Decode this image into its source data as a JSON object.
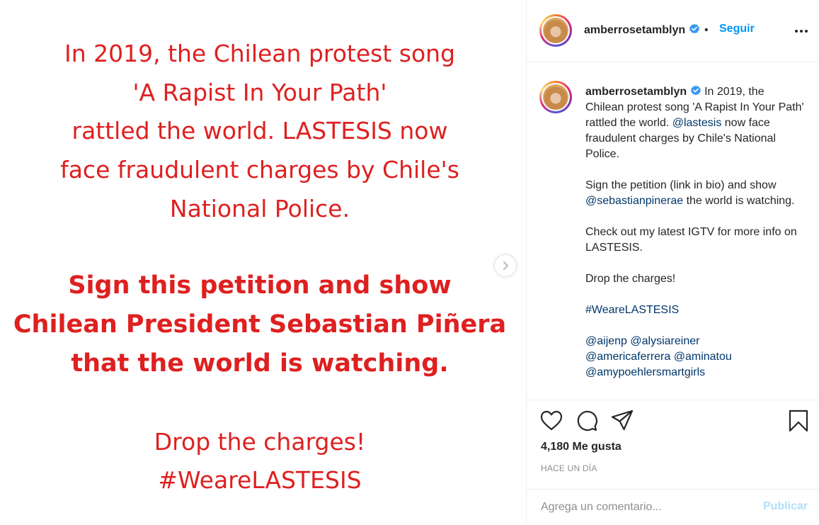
{
  "post_image": {
    "lines": [
      "In 2019, the Chilean protest song",
      "'A Rapist In Your Path'",
      "rattled the world. LASTESIS now",
      "face fraudulent charges by Chile's",
      "National Police.",
      "Sign this petition and show",
      "Chilean President Sebastian Piñera",
      "that the world is watching.",
      "Drop the charges!",
      "#WeareLASTESIS"
    ],
    "text_color": "#de2020"
  },
  "header": {
    "username": "amberrosetamblyn",
    "separator": "•",
    "follow_label": "Seguir",
    "more_icon": "more-horizontal-icon"
  },
  "caption": {
    "username": "amberrosetamblyn",
    "p1_a": "In 2019, the Chilean protest song 'A Rapist In Your Path' rattled the world.",
    "p1_mention": "@lastesis",
    "p1_b": "now face fraudulent charges by Chile's National Police.",
    "p2_a": "Sign the petition (link in bio) and show",
    "p2_mention": "@sebastianpinerae",
    "p2_b": "the world is watching.",
    "p3": "Check out my latest IGTV for more info on LASTESIS.",
    "p4": "Drop the charges!",
    "hashtag": "#WeareLASTESIS",
    "mentions": [
      "@aijenp",
      "@alysiareiner",
      "@americaferrera",
      "@aminatou",
      "@amypoehlersmartgirls"
    ]
  },
  "actions": {
    "icons": [
      "heart-icon",
      "comment-icon",
      "share-icon",
      "bookmark-icon"
    ],
    "likes": "4,180 Me gusta",
    "time": "HACE UN DÍA"
  },
  "comment_box": {
    "placeholder": "Agrega un comentario...",
    "publish_label": "Publicar"
  },
  "colors": {
    "accent": "#0095f6",
    "mention": "#00376b",
    "publish_disabled": "#b2dffc",
    "verified": "#3897f0"
  }
}
